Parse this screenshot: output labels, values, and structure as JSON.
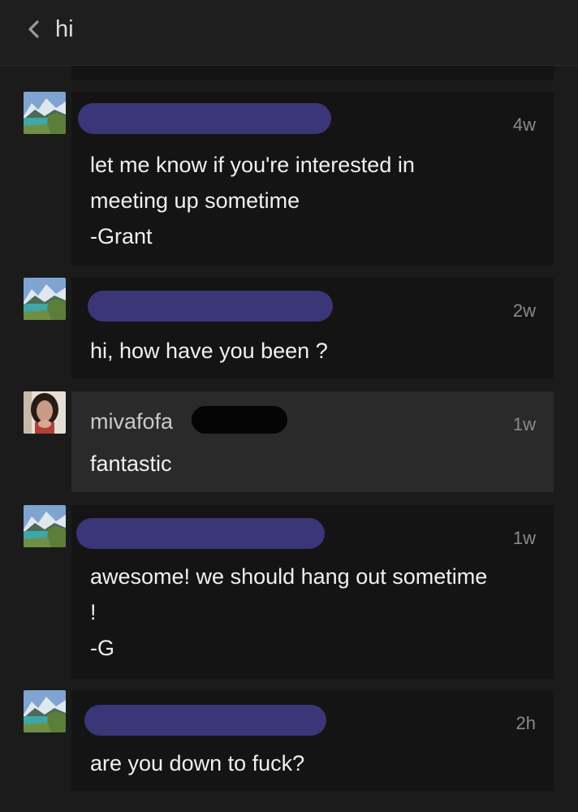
{
  "header": {
    "title": "hi"
  },
  "messages": [
    {
      "author": "",
      "time": "4w",
      "body": "let me know if you're interested in\nmeeting up sometime\n-Grant"
    },
    {
      "author": "",
      "time": "2w",
      "body": "hi, how have you been ?"
    },
    {
      "author": "mivafofa",
      "time": "1w",
      "body": "fantastic"
    },
    {
      "author": "",
      "time": "1w",
      "body": "awesome! we should hang out sometime\n!\n-G"
    },
    {
      "author": "",
      "time": "2h",
      "body": "are you down to fuck?"
    }
  ],
  "colors": {
    "background": "#1b1b1b",
    "card": "#141414",
    "own_card": "#2a2a2a",
    "redaction": "#3b3678"
  },
  "icons": {
    "back": "chevron-left-icon",
    "avatar_other": "mountain-lake-avatar",
    "avatar_self": "user-photo-avatar"
  }
}
